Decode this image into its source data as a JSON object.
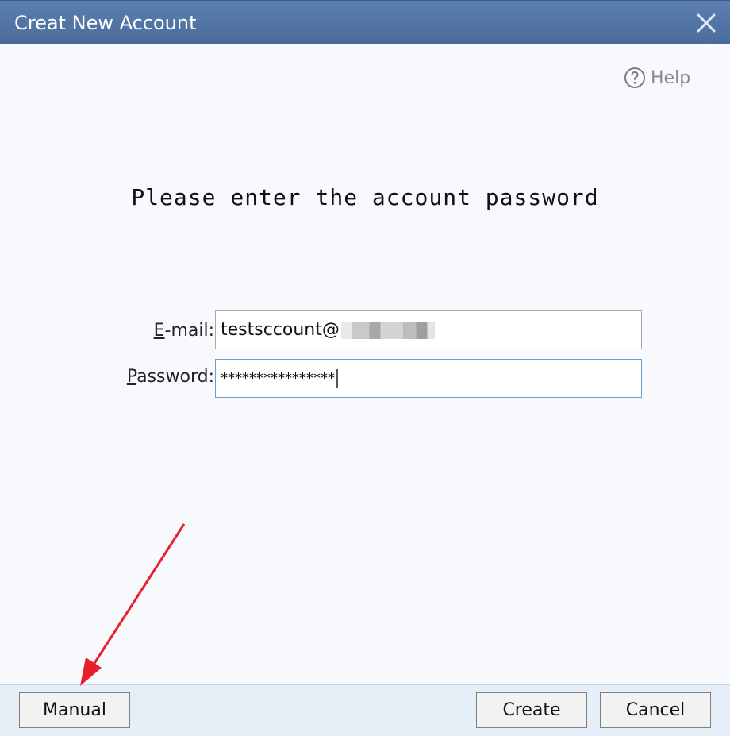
{
  "window": {
    "title": "Creat New Account",
    "close_icon": "close-icon"
  },
  "help": {
    "label": "Help",
    "icon": "question-circle-icon"
  },
  "heading": "Please enter the account password",
  "form": {
    "email_label_mnemonic": "E",
    "email_label_rest": "-mail:",
    "email_value_visible": "testsccount@",
    "password_label_mnemonic": "P",
    "password_label_rest": "assword:",
    "password_value": "****************"
  },
  "buttons": {
    "manual": "Manual",
    "create": "Create",
    "cancel": "Cancel"
  },
  "colors": {
    "titlebar": "#4a6c9d",
    "annotation_arrow": "#e8202a",
    "focused_field_border": "#6e9ccc"
  }
}
